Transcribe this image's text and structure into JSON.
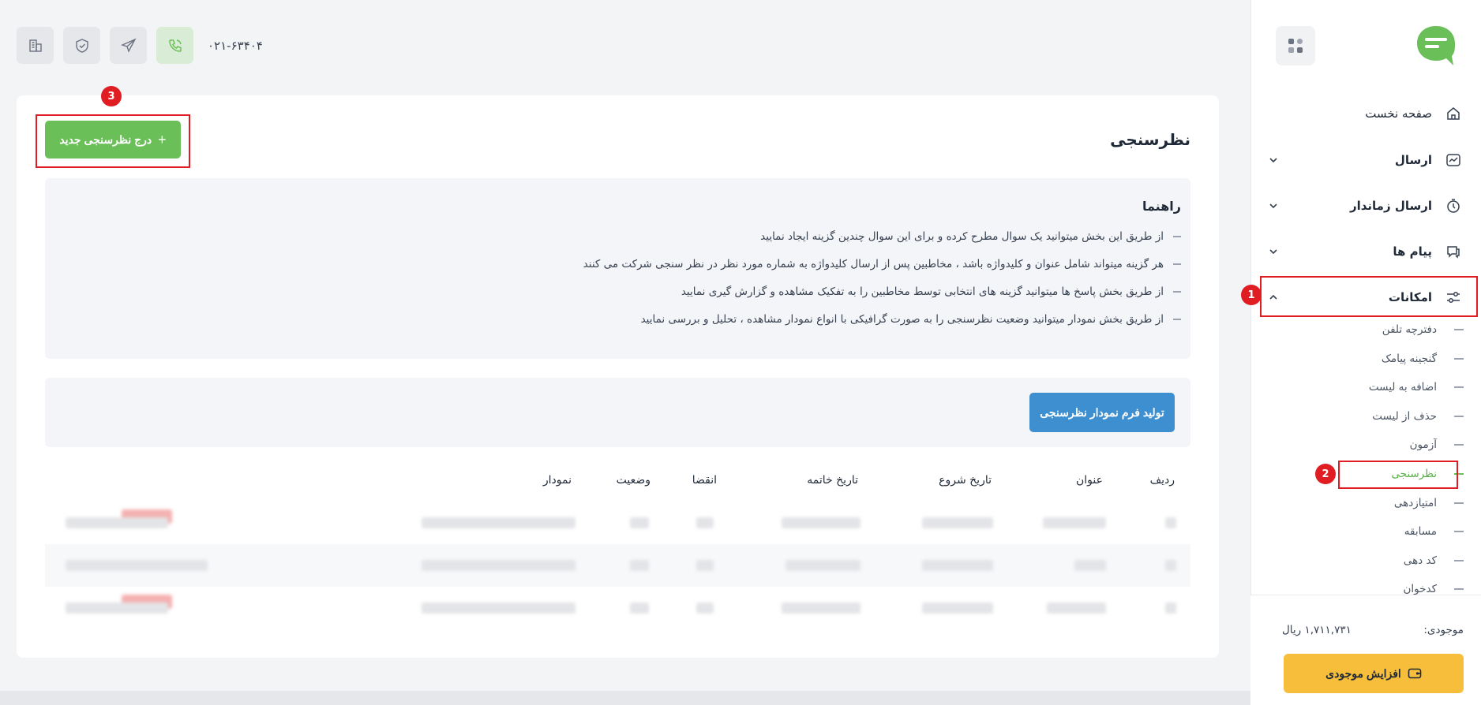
{
  "sidebar": {
    "nav": [
      {
        "label": "صفحه نخست",
        "icon": "home-icon",
        "has_chevron": false
      },
      {
        "label": "ارسال",
        "icon": "send-list-icon",
        "has_chevron": true
      },
      {
        "label": "ارسال زماندار",
        "icon": "timer-icon",
        "has_chevron": true
      },
      {
        "label": "پیام ها",
        "icon": "messages-icon",
        "has_chevron": true
      },
      {
        "label": "امکانات",
        "icon": "sliders-icon",
        "has_chevron": true,
        "expanded": true
      }
    ],
    "sub_items": [
      {
        "label": "دفترچه تلفن"
      },
      {
        "label": "گنجینه پیامک"
      },
      {
        "label": "اضافه به لیست"
      },
      {
        "label": "حذف از لیست"
      },
      {
        "label": "آزمون"
      },
      {
        "label": "نظرسنجی",
        "active": true
      },
      {
        "label": "امتیازدهی"
      },
      {
        "label": "مسابقه"
      },
      {
        "label": "کد دهی"
      },
      {
        "label": "کدخوان"
      }
    ],
    "balance_label": "موجودی:",
    "balance_value": "۱,۷۱۱,۷۳۱ ریال",
    "topup_label": "افزایش موجودی"
  },
  "topbar": {
    "phone": "۰۲۱-۶۳۴۰۴"
  },
  "annotations": {
    "badge1": "1",
    "badge2": "2",
    "badge3": "3"
  },
  "main": {
    "title": "نظرسنجی",
    "add_button": "درج نظرسنجی جدید",
    "guide_title": "راهنما",
    "guide_lines": [
      "از طریق این بخش میتوانید یک سوال مطرح کرده و برای این سوال چندین گزینه ایجاد نمایید",
      "هر گزینه میتواند شامل عنوان و کلیدواژه باشد ، مخاطبین پس از ارسال کلیدواژه به شماره مورد نظر در نظر سنجی شرکت می کنند",
      "از طریق بخش پاسخ ها میتوانید گزینه های انتخابی توسط مخاطبین را به تفکیک مشاهده و گزارش گیری نمایید",
      "از طریق بخش نمودار میتوانید وضعیت نظرسنجی را به صورت گرافیکی با انواع نمودار مشاهده ، تحلیل و بررسی نمایید"
    ],
    "chart_button": "تولید فرم نمودار نظرسنجی",
    "table_headers": {
      "row": "ردیف",
      "title": "عنوان",
      "start": "تاریخ شروع",
      "end": "تاریخ خاتمه",
      "expiry": "انقضا",
      "status": "وضعیت",
      "chart": "نمودار"
    }
  },
  "colors": {
    "accent_green": "#6bbf59",
    "chart_blue": "#3e8fd0",
    "topup_yellow": "#f6be3b",
    "highlight_red": "#e11d24"
  }
}
